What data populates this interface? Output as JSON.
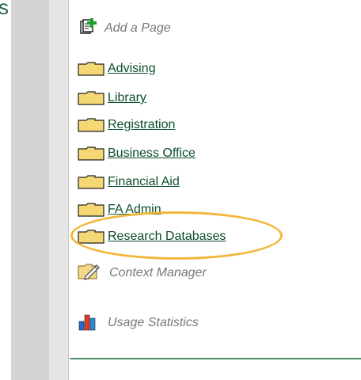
{
  "top_fragment": "s",
  "menu": {
    "add_page": {
      "label": "Add a Page",
      "icon": "add-page-icon"
    },
    "folders": [
      {
        "label": "Advising",
        "icon": "folder-icon"
      },
      {
        "label": "Library",
        "icon": "folder-icon"
      },
      {
        "label": "Registration",
        "icon": "folder-icon"
      },
      {
        "label": "Business Office",
        "icon": "folder-icon"
      },
      {
        "label": "Financial Aid",
        "icon": "folder-icon"
      },
      {
        "label": "FA Admin",
        "icon": "folder-icon"
      },
      {
        "label": "Research Databases",
        "icon": "folder-icon"
      }
    ],
    "context_manager": {
      "label": "Context Manager",
      "icon": "context-manager-icon"
    },
    "usage_statistics": {
      "label": "Usage Statistics",
      "icon": "bar-chart-icon"
    }
  },
  "colors": {
    "link": "#0b4f2a",
    "highlight": "#f2b63a",
    "folder": "#f5d774"
  }
}
